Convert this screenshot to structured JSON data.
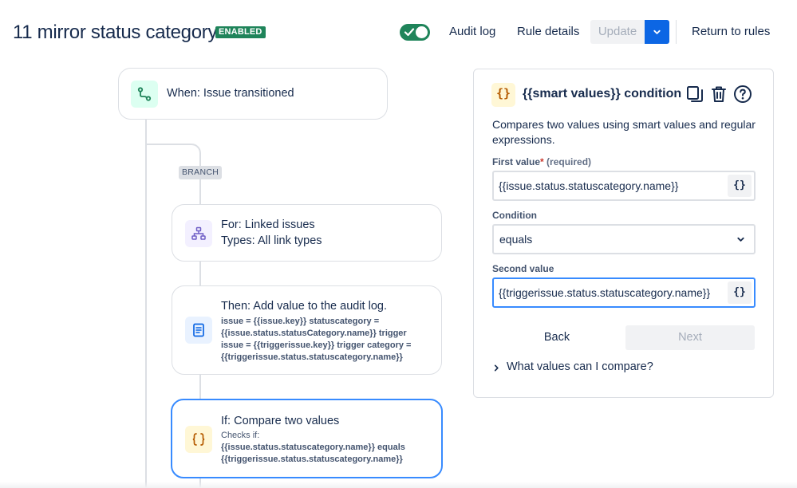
{
  "header": {
    "title": "11 mirror status category",
    "status_badge": "ENABLED",
    "toggle_on": true,
    "audit_log": "Audit log",
    "rule_details": "Rule details",
    "update": "Update",
    "return_to_rules": "Return to rules"
  },
  "flow": {
    "trigger": {
      "title": "When: Issue transitioned",
      "icon": "transition-icon"
    },
    "branch_tag": "BRANCH",
    "branch": {
      "title": "For: Linked issues",
      "subtitle": "Types: All link types",
      "icon": "hierarchy-icon"
    },
    "action": {
      "title": "Then: Add value to the audit log.",
      "detail": "issue = {{issue.key}} statuscategory = {{issue.status.statusCategory.name}} trigger issue = {{triggerissue.key}} trigger category = {{triggerissue.status.statuscategory.name}}",
      "icon": "document-icon"
    },
    "condition": {
      "title": "If: Compare two values",
      "checks_label": "Checks if:",
      "detail": "{{issue.status.statuscategory.name}} equals {{triggerissue.status.statuscategory.name}}",
      "icon": "braces-icon"
    }
  },
  "panel": {
    "icon_glyph": "{}",
    "title": "{{smart values}} condition",
    "description": "Compares two values using smart values and regular expressions.",
    "first_value_label": "First value",
    "required_marker": "*",
    "required_hint": "(required)",
    "first_value": "{{issue.status.statuscategory.name}}",
    "condition_label": "Condition",
    "condition_value": "equals",
    "second_value_label": "Second value",
    "second_value": "{{triggerissue.status.statuscategory.name}}",
    "brace_button": "{}",
    "back": "Back",
    "next": "Next",
    "expander": "What values can I compare?"
  },
  "colors": {
    "enabled_green": "#1f845a",
    "primary_blue": "#0c66e4",
    "focus_blue": "#388bff",
    "text": "#172b4d"
  }
}
